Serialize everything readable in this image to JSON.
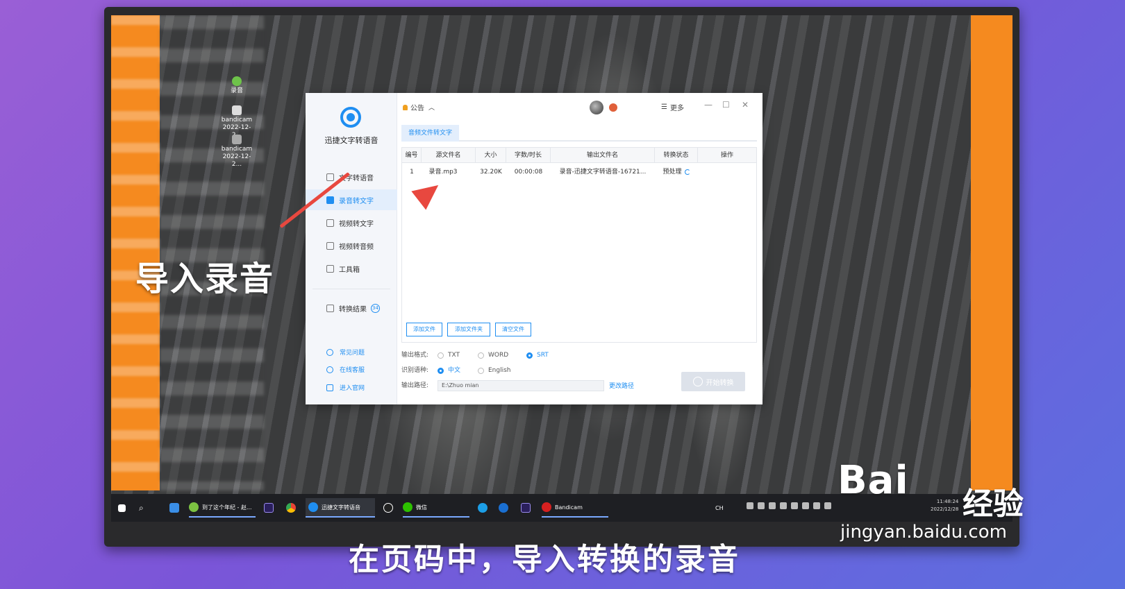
{
  "overlay_title": "导入录音",
  "subtitle": "在页码中，导入转换的录音",
  "watermark": {
    "brand": "Bai",
    "brand2": "经验",
    "url": "jingyan.baidu.com"
  },
  "desktop_icons": [
    {
      "label": "录音"
    },
    {
      "label": "bandicam 2022-12-2..."
    },
    {
      "label": "bandicam 2022-12-2..."
    }
  ],
  "app": {
    "name": "迅捷文字转语音",
    "nav": [
      {
        "label": "文字转语音"
      },
      {
        "label": "录音转文字"
      },
      {
        "label": "视频转文字"
      },
      {
        "label": "视频转音频"
      },
      {
        "label": "工具箱"
      }
    ],
    "results": {
      "label": "转换结果",
      "count": "34"
    },
    "help": [
      {
        "label": "常见问题"
      },
      {
        "label": "在线客服"
      },
      {
        "label": "进入官网"
      }
    ],
    "notice_label": "公告",
    "more_label": "更多",
    "tab_label": "音频文件转文字",
    "table": {
      "headers": [
        "编号",
        "源文件名",
        "大小",
        "字数/时长",
        "输出文件名",
        "转换状态",
        "操作"
      ],
      "rows": [
        {
          "no": "1",
          "source": "录音.mp3",
          "size": "32.20K",
          "duration": "00:00:08",
          "output": "录音-迅捷文字转语音-16721...",
          "status": "预处理"
        }
      ]
    },
    "buttons": {
      "add_file": "添加文件",
      "add_folder": "添加文件夹",
      "clear": "清空文件"
    },
    "output_format": {
      "label": "输出格式:",
      "options": [
        "TXT",
        "WORD",
        "SRT"
      ],
      "selected": "SRT"
    },
    "language": {
      "label": "识别语种:",
      "options": [
        "中文",
        "English"
      ],
      "selected": "中文"
    },
    "output_path": {
      "label": "输出路径:",
      "value": "E:\\Zhuo mian",
      "change_label": "更改路径"
    },
    "start_label": "开始转换"
  },
  "taskbar": {
    "items": [
      {
        "label": "到了这个年纪 - 赵..."
      },
      {
        "label": "迅捷文字转语音"
      },
      {
        "label": "微信"
      },
      {
        "label": "Bandicam"
      }
    ],
    "ime": "CH",
    "clock_time": "11:48:24",
    "clock_date": "2022/12/28"
  }
}
